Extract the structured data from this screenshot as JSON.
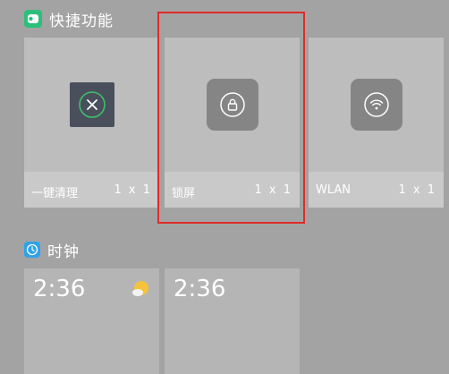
{
  "quick_functions": {
    "title": "快捷功能",
    "tiles": [
      {
        "name": "一键清理",
        "size": "1 x 1",
        "icon": "clean-x-icon"
      },
      {
        "name": "锁屏",
        "size": "1 x 1",
        "icon": "lock-icon"
      },
      {
        "name": "WLAN",
        "size": "1 x 1",
        "icon": "wifi-icon"
      }
    ]
  },
  "clock": {
    "title": "时钟",
    "widgets": [
      {
        "time": "2:36",
        "icon": "weather-sun-icon"
      },
      {
        "time": "2:36"
      }
    ]
  },
  "colors": {
    "background": "#a3a3a3",
    "highlight": "#e02a2a",
    "accent_green": "#2bbf7a",
    "accent_blue": "#2fa3e8"
  }
}
